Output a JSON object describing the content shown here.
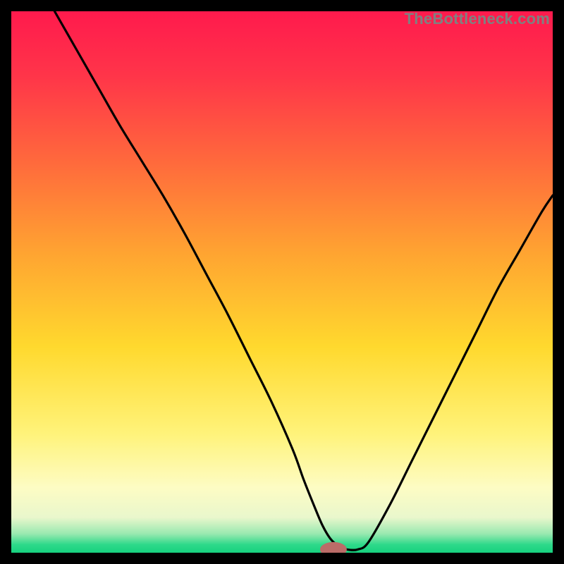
{
  "watermark": {
    "text": "TheBottleneck.com"
  },
  "colors": {
    "gradient_stops": [
      {
        "offset": 0.0,
        "color": "#ff1a4d"
      },
      {
        "offset": 0.12,
        "color": "#ff3549"
      },
      {
        "offset": 0.28,
        "color": "#ff6a3c"
      },
      {
        "offset": 0.45,
        "color": "#ffa531"
      },
      {
        "offset": 0.62,
        "color": "#ffd92e"
      },
      {
        "offset": 0.78,
        "color": "#fff37a"
      },
      {
        "offset": 0.88,
        "color": "#fdfcc4"
      },
      {
        "offset": 0.935,
        "color": "#e9f7cc"
      },
      {
        "offset": 0.965,
        "color": "#99e9b0"
      },
      {
        "offset": 0.985,
        "color": "#2ed98a"
      },
      {
        "offset": 1.0,
        "color": "#17d17f"
      }
    ],
    "curve": "#000000",
    "marker_fill": "#bb6c68",
    "marker_stroke": "#bb6c68",
    "frame": "#000000"
  },
  "chart_data": {
    "type": "line",
    "title": "",
    "xlabel": "",
    "ylabel": "",
    "xlim": [
      0,
      100
    ],
    "ylim": [
      0,
      100
    ],
    "grid": false,
    "series": [
      {
        "name": "bottleneck-curve",
        "x": [
          8,
          12,
          16,
          20,
          24,
          28,
          32,
          36,
          40,
          44,
          48,
          52,
          54,
          56,
          57.5,
          59,
          60.5,
          62,
          64,
          66,
          70,
          74,
          78,
          82,
          86,
          90,
          94,
          98,
          100
        ],
        "y": [
          100,
          93,
          86,
          79,
          72.5,
          66,
          59,
          51.5,
          44,
          36,
          28,
          19,
          13.5,
          8.5,
          5,
          2.5,
          1.2,
          0.6,
          0.6,
          2.0,
          9,
          17,
          25,
          33,
          41,
          49,
          56,
          63,
          66
        ]
      }
    ],
    "flat_bottom": {
      "x_start": 57.5,
      "x_end": 62,
      "y": 0.6
    },
    "marker": {
      "x": 59.5,
      "y": 0.6,
      "rx": 2.4,
      "ry": 1.3
    },
    "annotations": []
  }
}
